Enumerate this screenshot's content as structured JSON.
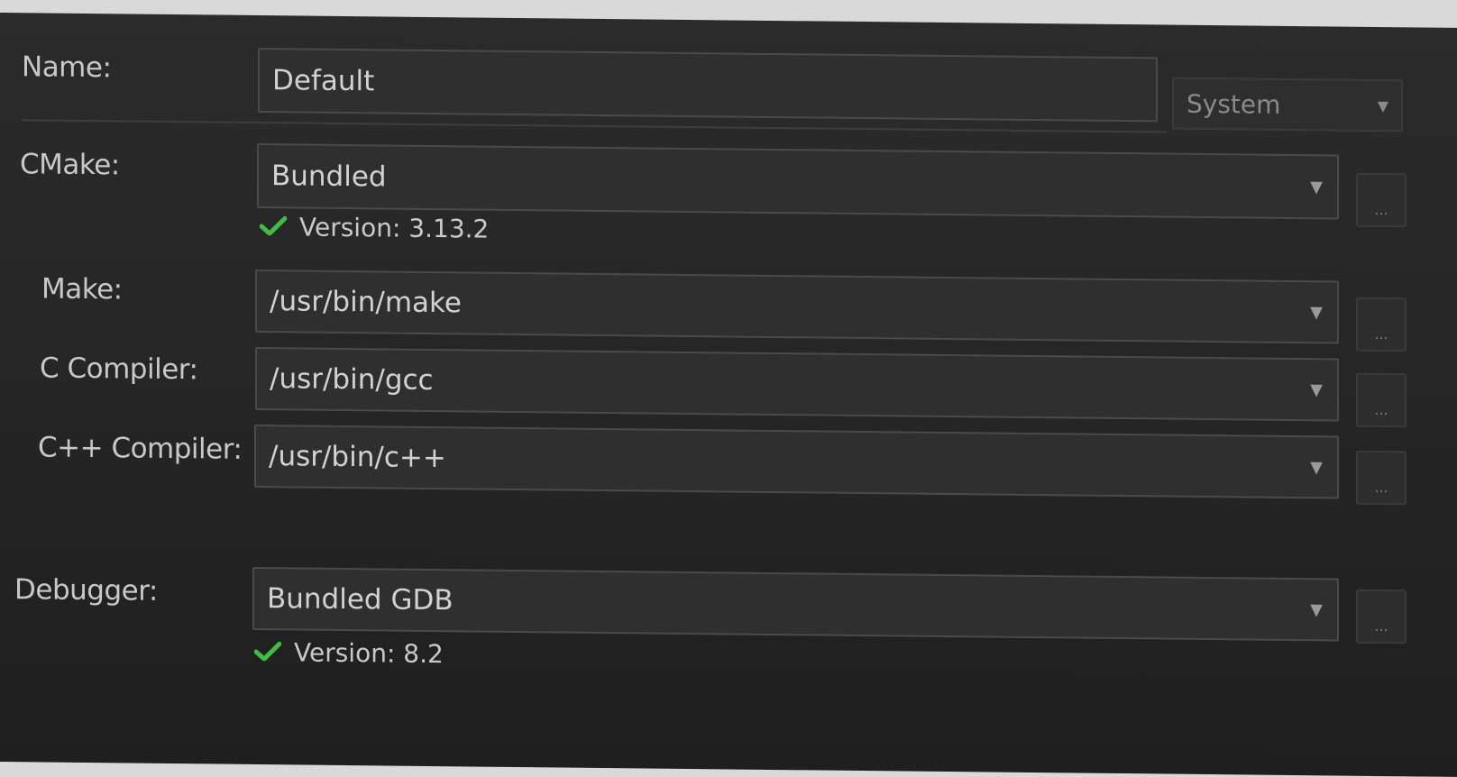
{
  "form": {
    "name": {
      "label": "Name:",
      "value": "Default",
      "scope": "System"
    },
    "cmake": {
      "label": "CMake:",
      "value": "Bundled",
      "version": "Version: 3.13.2"
    },
    "make": {
      "label": "Make:",
      "value": "/usr/bin/make"
    },
    "c_compiler": {
      "label": "C Compiler:",
      "value": "/usr/bin/gcc"
    },
    "cpp_compiler": {
      "label": "C++ Compiler:",
      "value": "/usr/bin/c++"
    },
    "debugger": {
      "label": "Debugger:",
      "value": "Bundled GDB",
      "version": "Version: 8.2"
    },
    "browse_label": "..."
  },
  "icons": {
    "dropdown": "chevron-down-icon",
    "status_ok": "checkmark-icon"
  },
  "colors": {
    "background": "#262626",
    "field": "#2f2f2f",
    "text": "#c8c8c8",
    "check": "#3fbf3f"
  }
}
